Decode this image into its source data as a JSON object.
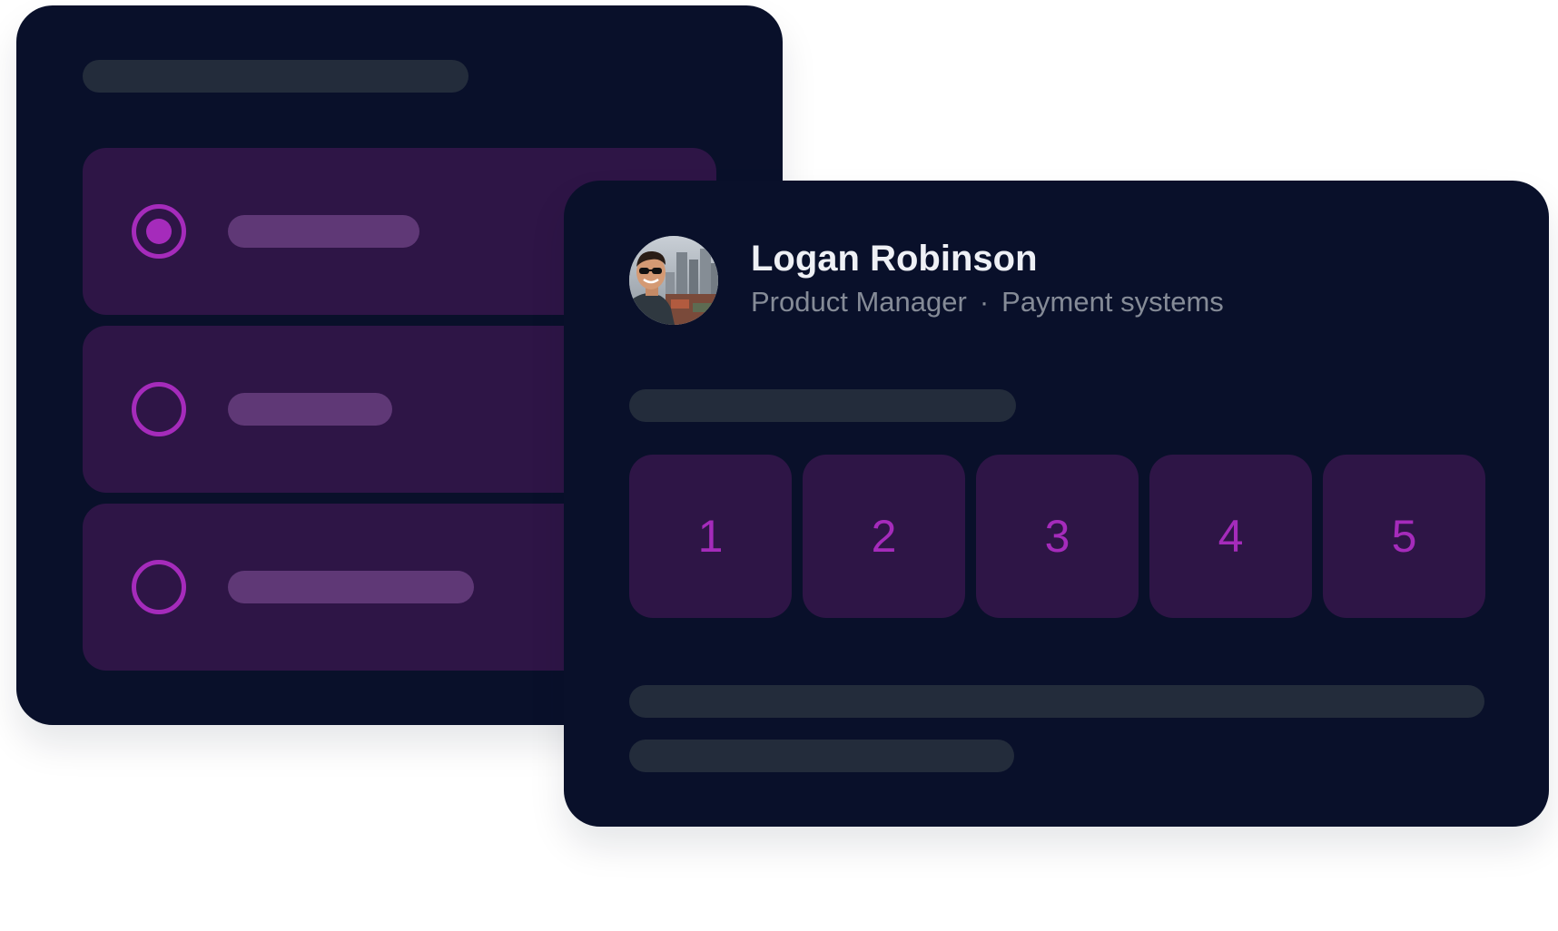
{
  "profile": {
    "name": "Logan Robinson",
    "role": "Product Manager",
    "separator": "·",
    "team": "Payment systems"
  },
  "radio_options": [
    {
      "selected": true
    },
    {
      "selected": false
    },
    {
      "selected": false
    }
  ],
  "rating": {
    "options": [
      "1",
      "2",
      "3",
      "4",
      "5"
    ]
  },
  "icons": {
    "radio": "radio-icon",
    "avatar": "avatar-photo"
  },
  "colors": {
    "card_background": "#09102a",
    "option_background": "#2e1546",
    "accent": "#a52bbb",
    "skeleton": "#232c3b",
    "option_bar": "#5f3876",
    "name_text": "#eef0f5",
    "meta_text": "#858b97"
  }
}
